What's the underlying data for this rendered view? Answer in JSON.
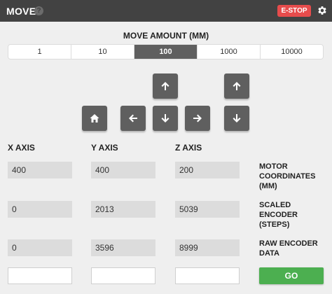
{
  "header": {
    "title": "MOVE",
    "help_glyph": "?",
    "estop_label": "E-STOP",
    "settings_icon": "gear-icon",
    "colors": {
      "bar": "#424242",
      "estop": "#e74c4c"
    }
  },
  "move_amount": {
    "title": "MOVE AMOUNT (MM)",
    "options": [
      "1",
      "10",
      "100",
      "1000",
      "10000"
    ],
    "selected": "100"
  },
  "jog_buttons": {
    "icons": [
      "home-icon",
      "arrow-up-icon",
      "arrow-left-icon",
      "arrow-down-icon",
      "arrow-right-icon",
      "arrow-up-icon",
      "arrow-down-icon"
    ]
  },
  "axes": {
    "x": "X AXIS",
    "y": "Y AXIS",
    "z": "Z AXIS"
  },
  "rows": {
    "motor": {
      "label": "MOTOR COORDINATES (MM)",
      "x": "400",
      "y": "400",
      "z": "200"
    },
    "scaled": {
      "label": "SCALED ENCODER (STEPS)",
      "x": "0",
      "y": "2013",
      "z": "5039"
    },
    "raw": {
      "label": "RAW ENCODER DATA",
      "x": "0",
      "y": "3596",
      "z": "8999"
    }
  },
  "inputs": {
    "x_value": "",
    "y_value": "",
    "z_value": ""
  },
  "go_label": "GO",
  "colors": {
    "accent_go": "#4caf50",
    "active_segment": "#5f5f5f"
  }
}
